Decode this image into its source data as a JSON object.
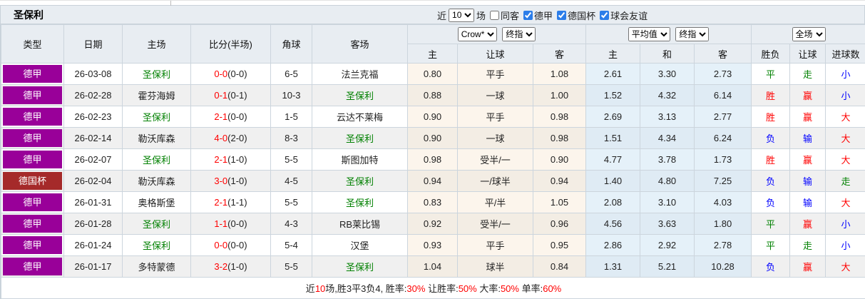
{
  "title": "圣保利",
  "toolbar": {
    "near_label": "近",
    "games_selected": "10",
    "games_suffix": "场",
    "checkboxes": [
      {
        "label": "同客",
        "checked": false
      },
      {
        "label": "德甲",
        "checked": true
      },
      {
        "label": "德国杯",
        "checked": true
      },
      {
        "label": "球会友谊",
        "checked": true
      }
    ]
  },
  "header": {
    "base_columns": [
      "类型",
      "日期",
      "主场",
      "比分(半场)",
      "角球",
      "客场"
    ],
    "crow_group": {
      "select1": "Crow*",
      "select2": "终指",
      "columns": [
        "主",
        "让球",
        "客"
      ]
    },
    "avg_group": {
      "select1": "平均值",
      "select2": "终指",
      "columns": [
        "主",
        "和",
        "客"
      ]
    },
    "result_group": {
      "select1": "全场",
      "columns": [
        "胜负",
        "让球",
        "进球数"
      ]
    }
  },
  "focus_team": "圣保利",
  "colors": {
    "focus_team": "#008000",
    "league": {
      "德甲": "#990099",
      "德国杯": "#a52a2a"
    },
    "outcome": {
      "胜": "#ff0000",
      "平": "#008000",
      "负": "#0000ff",
      "赢": "#ff0000",
      "输": "#0000ff",
      "走": "#008000",
      "大": "#ff0000",
      "小": "#0000ff"
    }
  },
  "rows": [
    {
      "league": "德甲",
      "date": "26-03-08",
      "home": "圣保利",
      "score_ft": "0-0",
      "score_ht": "(0-0)",
      "corners": "6-5",
      "away": "法兰克福",
      "crow_home": "0.80",
      "crow_handicap": "平手",
      "crow_away": "1.08",
      "avg_home": "2.61",
      "avg_draw": "3.30",
      "avg_away": "2.73",
      "result_wdl": "平",
      "result_handicap": "走",
      "result_goals": "小"
    },
    {
      "league": "德甲",
      "date": "26-02-28",
      "home": "霍芬海姆",
      "score_ft": "0-1",
      "score_ht": "(0-1)",
      "corners": "10-3",
      "away": "圣保利",
      "crow_home": "0.88",
      "crow_handicap": "一球",
      "crow_away": "1.00",
      "avg_home": "1.52",
      "avg_draw": "4.32",
      "avg_away": "6.14",
      "result_wdl": "胜",
      "result_handicap": "赢",
      "result_goals": "小"
    },
    {
      "league": "德甲",
      "date": "26-02-23",
      "home": "圣保利",
      "score_ft": "2-1",
      "score_ht": "(0-0)",
      "corners": "1-5",
      "away": "云达不莱梅",
      "crow_home": "0.90",
      "crow_handicap": "平手",
      "crow_away": "0.98",
      "avg_home": "2.69",
      "avg_draw": "3.13",
      "avg_away": "2.77",
      "result_wdl": "胜",
      "result_handicap": "赢",
      "result_goals": "大"
    },
    {
      "league": "德甲",
      "date": "26-02-14",
      "home": "勒沃库森",
      "score_ft": "4-0",
      "score_ht": "(2-0)",
      "corners": "8-3",
      "away": "圣保利",
      "crow_home": "0.90",
      "crow_handicap": "一球",
      "crow_away": "0.98",
      "avg_home": "1.51",
      "avg_draw": "4.34",
      "avg_away": "6.24",
      "result_wdl": "负",
      "result_handicap": "输",
      "result_goals": "大"
    },
    {
      "league": "德甲",
      "date": "26-02-07",
      "home": "圣保利",
      "score_ft": "2-1",
      "score_ht": "(1-0)",
      "corners": "5-5",
      "away": "斯图加特",
      "crow_home": "0.98",
      "crow_handicap": "受半/一",
      "crow_away": "0.90",
      "avg_home": "4.77",
      "avg_draw": "3.78",
      "avg_away": "1.73",
      "result_wdl": "胜",
      "result_handicap": "赢",
      "result_goals": "大"
    },
    {
      "league": "德国杯",
      "date": "26-02-04",
      "home": "勒沃库森",
      "score_ft": "3-0",
      "score_ht": "(1-0)",
      "corners": "4-5",
      "away": "圣保利",
      "crow_home": "0.94",
      "crow_handicap": "一/球半",
      "crow_away": "0.94",
      "avg_home": "1.40",
      "avg_draw": "4.80",
      "avg_away": "7.25",
      "result_wdl": "负",
      "result_handicap": "输",
      "result_goals": "走"
    },
    {
      "league": "德甲",
      "date": "26-01-31",
      "home": "奥格斯堡",
      "score_ft": "2-1",
      "score_ht": "(1-1)",
      "corners": "5-5",
      "away": "圣保利",
      "crow_home": "0.83",
      "crow_handicap": "平/半",
      "crow_away": "1.05",
      "avg_home": "2.08",
      "avg_draw": "3.10",
      "avg_away": "4.03",
      "result_wdl": "负",
      "result_handicap": "输",
      "result_goals": "大"
    },
    {
      "league": "德甲",
      "date": "26-01-28",
      "home": "圣保利",
      "score_ft": "1-1",
      "score_ht": "(0-0)",
      "corners": "4-3",
      "away": "RB莱比锡",
      "crow_home": "0.92",
      "crow_handicap": "受半/一",
      "crow_away": "0.96",
      "avg_home": "4.56",
      "avg_draw": "3.63",
      "avg_away": "1.80",
      "result_wdl": "平",
      "result_handicap": "赢",
      "result_goals": "小"
    },
    {
      "league": "德甲",
      "date": "26-01-24",
      "home": "圣保利",
      "score_ft": "0-0",
      "score_ht": "(0-0)",
      "corners": "5-4",
      "away": "汉堡",
      "crow_home": "0.93",
      "crow_handicap": "平手",
      "crow_away": "0.95",
      "avg_home": "2.86",
      "avg_draw": "2.92",
      "avg_away": "2.78",
      "result_wdl": "平",
      "result_handicap": "走",
      "result_goals": "小"
    },
    {
      "league": "德甲",
      "date": "26-01-17",
      "home": "多特蒙德",
      "score_ft": "3-2",
      "score_ht": "(1-0)",
      "corners": "5-5",
      "away": "圣保利",
      "crow_home": "1.04",
      "crow_handicap": "球半",
      "crow_away": "0.84",
      "avg_home": "1.31",
      "avg_draw": "5.21",
      "avg_away": "10.28",
      "result_wdl": "负",
      "result_handicap": "赢",
      "result_goals": "大"
    }
  ],
  "summary": {
    "seg1": "近",
    "num1": "10",
    "seg2": "场,胜3平3负4, 胜率:",
    "num2": "30%",
    "seg3": " 让胜率:",
    "num3": "50%",
    "seg4": " 大率:",
    "num4": "50%",
    "seg5": " 单率:",
    "num5": "60%"
  }
}
